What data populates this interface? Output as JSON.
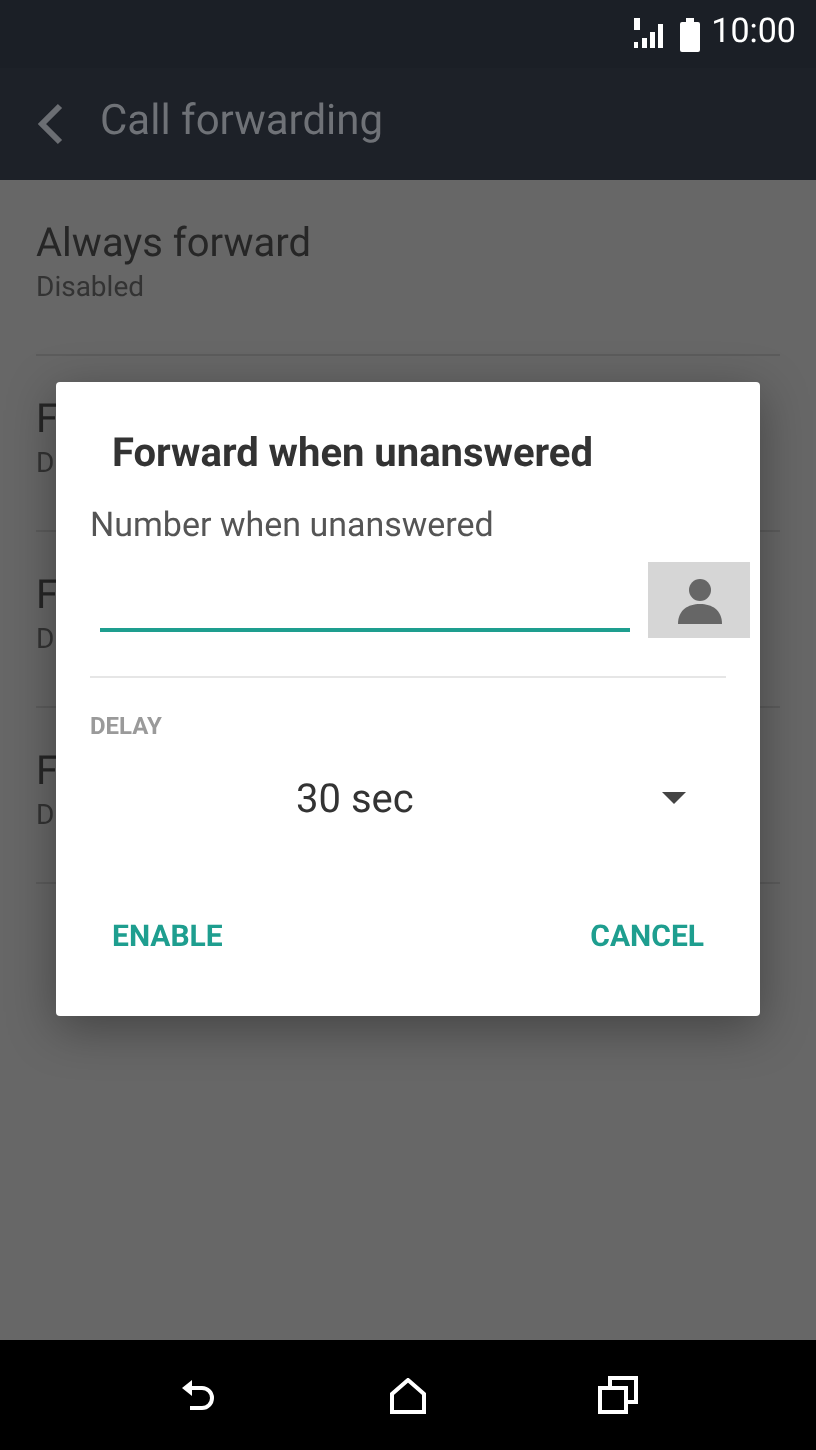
{
  "status_bar": {
    "time": "10:00"
  },
  "app_bar": {
    "title": "Call forwarding"
  },
  "list": [
    {
      "title": "Always forward",
      "subtitle": "Disabled"
    },
    {
      "title": "F",
      "subtitle": "D"
    },
    {
      "title": "F",
      "subtitle": "D"
    },
    {
      "title": "F",
      "subtitle": "D"
    }
  ],
  "dialog": {
    "title": "Forward when unanswered",
    "field_label": "Number when unanswered",
    "delay": {
      "label": "DELAY",
      "value": "30 sec"
    },
    "buttons": [
      "ENABLE",
      "CANCEL"
    ]
  }
}
